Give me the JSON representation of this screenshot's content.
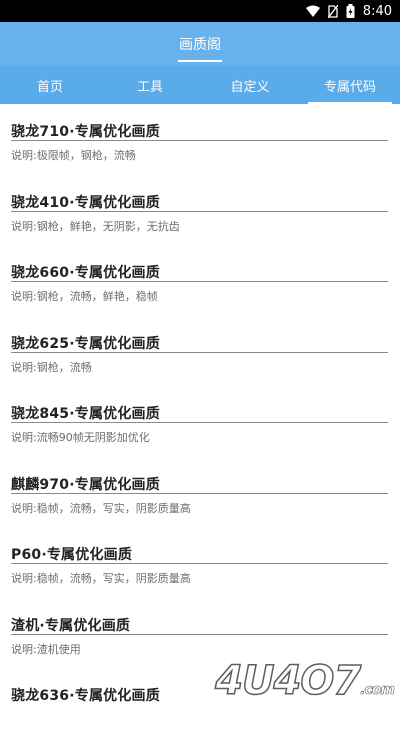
{
  "status": {
    "time": "8:40"
  },
  "header": {
    "title": "画质阁"
  },
  "tabs": [
    {
      "label": "首页"
    },
    {
      "label": "工具"
    },
    {
      "label": "自定义"
    },
    {
      "label": "专属代码"
    }
  ],
  "active_tab": 3,
  "items": [
    {
      "title": "骁龙710·专属优化画质",
      "desc": "说明:极限帧，钢枪，流畅"
    },
    {
      "title": "骁龙410·专属优化画质",
      "desc": "说明:钢枪，鲜艳，无阴影，无抗齿"
    },
    {
      "title": "骁龙660·专属优化画质",
      "desc": "说明:钢枪，流畅，鲜艳，稳帧"
    },
    {
      "title": "骁龙625·专属优化画质",
      "desc": "说明:钢枪，流畅"
    },
    {
      "title": "骁龙845·专属优化画质",
      "desc": "说明:流畅90帧无阴影加优化"
    },
    {
      "title": "麒麟970·专属优化画质",
      "desc": "说明:稳帧，流畅，写实，阴影质量高"
    },
    {
      "title": "P60·专属优化画质",
      "desc": "说明:稳帧，流畅，写实，阴影质量高"
    },
    {
      "title": "渣机·专属优化画质",
      "desc": "说明:渣机使用"
    },
    {
      "title": "骁龙636·专属优化画质",
      "desc": ""
    }
  ],
  "watermark": {
    "text": "4U4O7",
    "suffix": ".com"
  }
}
